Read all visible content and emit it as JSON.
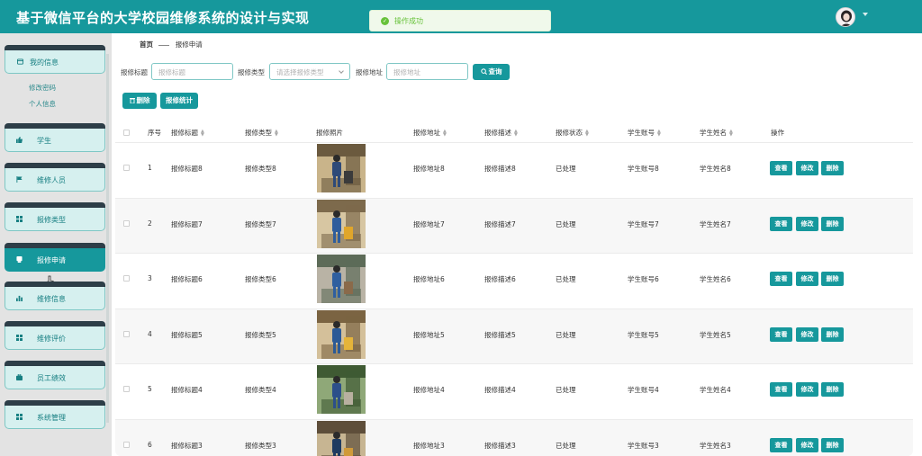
{
  "app": {
    "title": "基于微信平台的大学校园维修系统的设计与实现"
  },
  "toast": {
    "message": "操作成功",
    "icon": "check-circle-icon"
  },
  "header": {
    "avatar_icon": "user-avatar",
    "caret_icon": "caret-down-icon"
  },
  "sidebar": {
    "profile": {
      "label": "我的信息",
      "icon": "profile-card-icon",
      "subitems": [
        "修改密码",
        "个人信息"
      ]
    },
    "items": [
      {
        "label": "学生",
        "icon": "thumbs-up-icon"
      },
      {
        "label": "维修人员",
        "icon": "flag-icon"
      },
      {
        "label": "报修类型",
        "icon": "grid-icon"
      },
      {
        "label": "报修申请",
        "icon": "document-icon",
        "active": true
      },
      {
        "label": "维修信息",
        "icon": "bar-chart-icon"
      },
      {
        "label": "维修评价",
        "icon": "grid-icon"
      },
      {
        "label": "员工绩效",
        "icon": "briefcase-icon"
      },
      {
        "label": "系统管理",
        "icon": "grid-icon"
      }
    ]
  },
  "breadcrumb": {
    "home": "首页",
    "current": "报修申请"
  },
  "search": {
    "title_label": "报修标题",
    "title_placeholder": "报修标题",
    "type_label": "报修类型",
    "type_placeholder": "请选择报修类型",
    "address_label": "报修地址",
    "address_placeholder": "报修地址",
    "query_button": "查询"
  },
  "toolbar": {
    "delete_button": "删除",
    "stats_button": "报修统计"
  },
  "table": {
    "headers": {
      "index": "序号",
      "title": "报修标题",
      "type": "报修类型",
      "photo": "报修照片",
      "address": "报修地址",
      "desc": "报修描述",
      "status": "报修状态",
      "account": "学生账号",
      "name": "学生姓名",
      "ops": "操作"
    },
    "actions": {
      "view": "查看",
      "edit": "修改",
      "delete": "删除"
    },
    "rows": [
      {
        "index": "1",
        "title": "报修标题8",
        "type": "报修类型8",
        "address": "报修地址8",
        "desc": "报修描述8",
        "status": "已处理",
        "account": "学生账号8",
        "name": "学生姓名8"
      },
      {
        "index": "2",
        "title": "报修标题7",
        "type": "报修类型7",
        "address": "报修地址7",
        "desc": "报修描述7",
        "status": "已处理",
        "account": "学生账号7",
        "name": "学生姓名7"
      },
      {
        "index": "3",
        "title": "报修标题6",
        "type": "报修类型6",
        "address": "报修地址6",
        "desc": "报修描述6",
        "status": "已处理",
        "account": "学生账号6",
        "name": "学生姓名6"
      },
      {
        "index": "4",
        "title": "报修标题5",
        "type": "报修类型5",
        "address": "报修地址5",
        "desc": "报修描述5",
        "status": "已处理",
        "account": "学生账号5",
        "name": "学生姓名5"
      },
      {
        "index": "5",
        "title": "报修标题4",
        "type": "报修类型4",
        "address": "报修地址4",
        "desc": "报修描述4",
        "status": "已处理",
        "account": "学生账号4",
        "name": "学生姓名4"
      },
      {
        "index": "6",
        "title": "报修标题3",
        "type": "报修类型3",
        "address": "报修地址3",
        "desc": "报修描述3",
        "status": "已处理",
        "account": "学生账号3",
        "name": "学生姓名3"
      }
    ]
  },
  "colors": {
    "primary": "#16989c",
    "menu_bg": "#d6f0ef",
    "menu_cap": "#2d3e48",
    "toast_green": "#67c23a"
  }
}
